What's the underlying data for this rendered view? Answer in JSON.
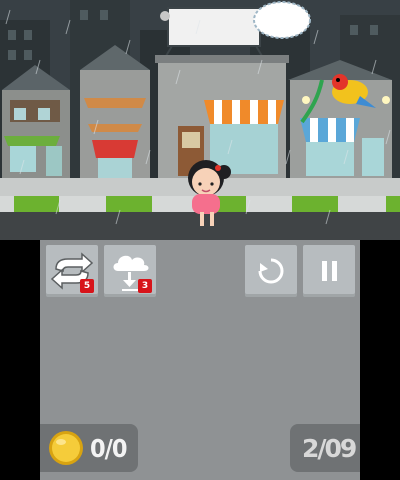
{
  "hud": {
    "swap_badge": "5",
    "rain_badge": "3",
    "coins": "0/0",
    "level": "2/09"
  },
  "colors": {
    "accent_badge": "#d7141a",
    "grass": "#6cb22f",
    "umbrella_orange": "#f08a2a",
    "umbrella_blue": "#5aa7d8"
  },
  "icons": [
    "swap-arrows-icon",
    "cloud-download-icon",
    "restart-icon",
    "pause-icon",
    "coin-icon"
  ]
}
